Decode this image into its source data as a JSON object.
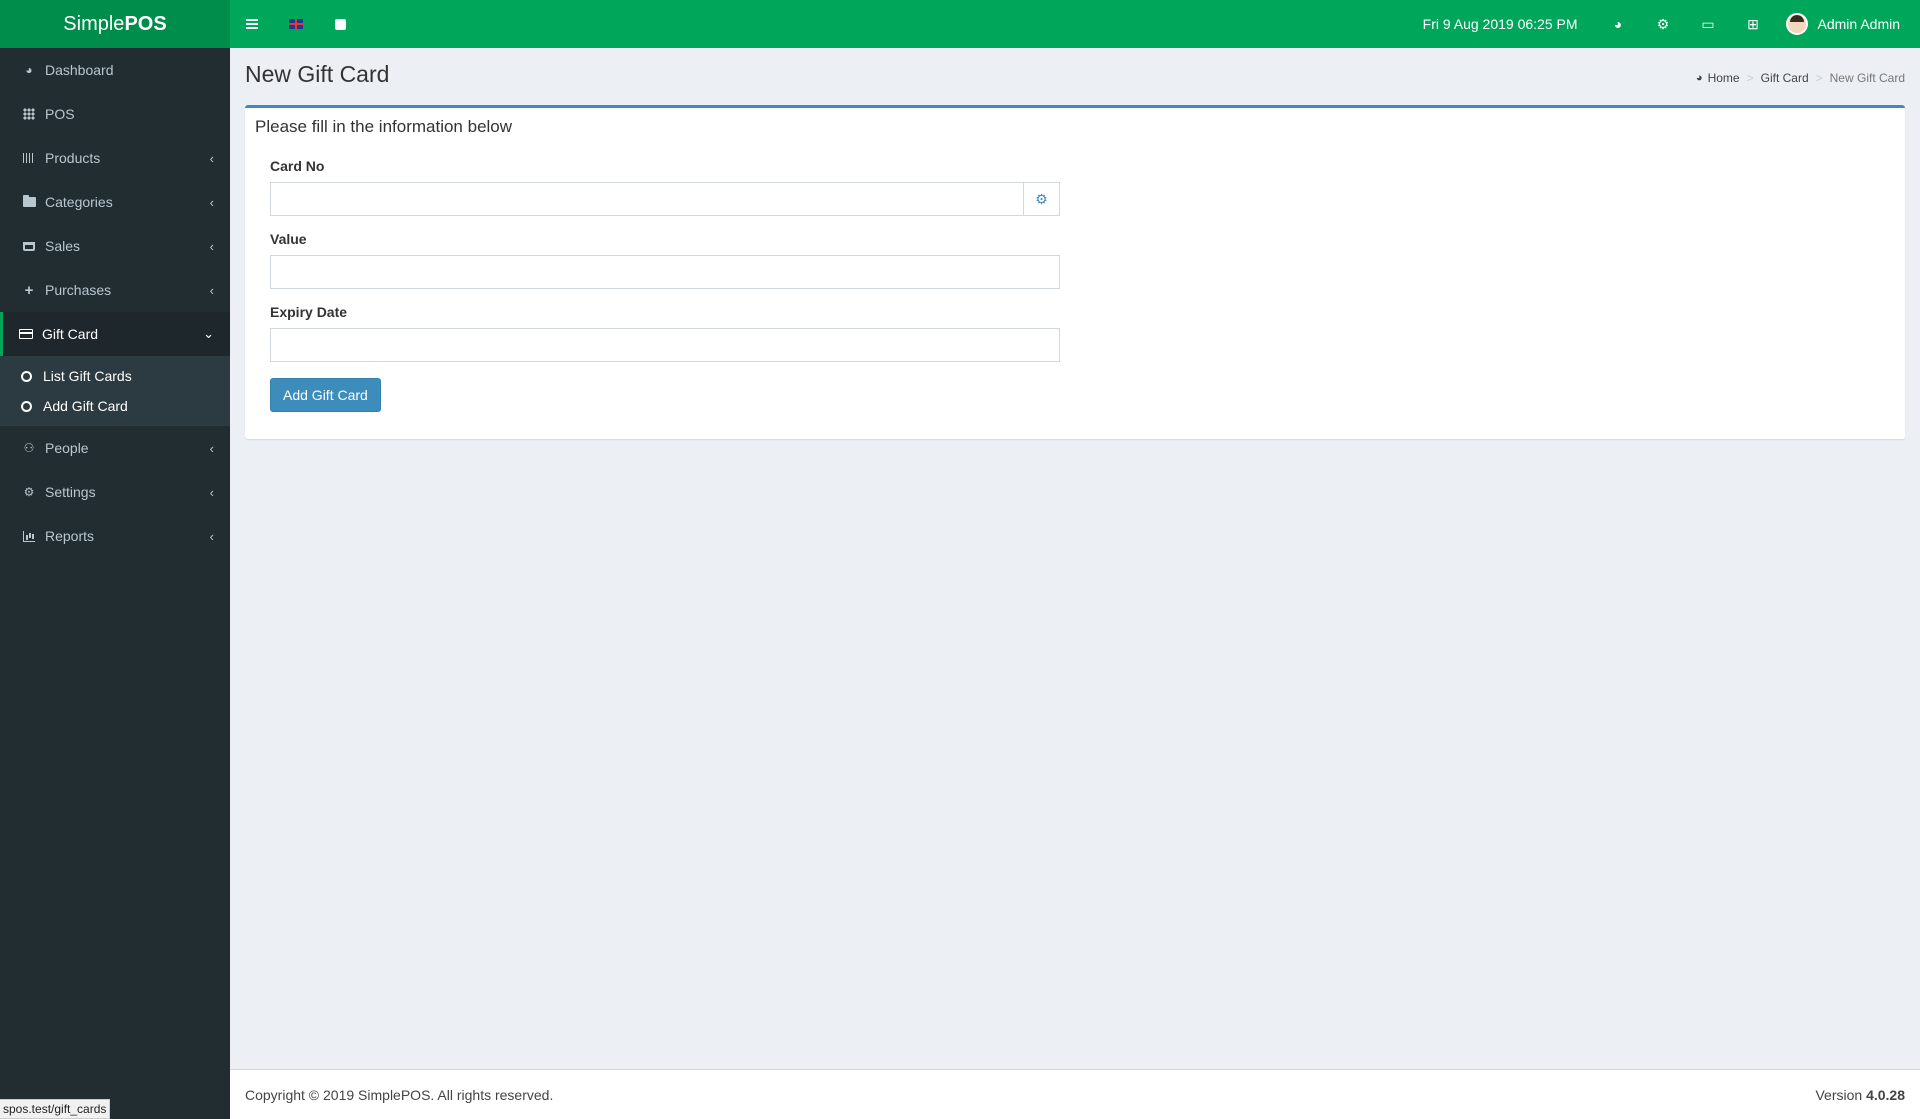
{
  "brand": {
    "light": "Simple",
    "bold": "POS"
  },
  "header": {
    "datetime": "Fri 9 Aug 2019 06:25 PM",
    "user_name": "Admin Admin"
  },
  "sidebar": {
    "items": [
      {
        "label": "Dashboard"
      },
      {
        "label": "POS"
      },
      {
        "label": "Products"
      },
      {
        "label": "Categories"
      },
      {
        "label": "Sales"
      },
      {
        "label": "Purchases"
      },
      {
        "label": "Gift Card"
      },
      {
        "label": "People"
      },
      {
        "label": "Settings"
      },
      {
        "label": "Reports"
      }
    ],
    "gift_card_sub": [
      {
        "label": "List Gift Cards"
      },
      {
        "label": "Add Gift Card"
      }
    ]
  },
  "page": {
    "title": "New Gift Card",
    "breadcrumb": [
      "Home",
      "Gift Card",
      "New Gift Card"
    ],
    "box_title": "Please fill in the information below"
  },
  "form": {
    "card_no_label": "Card No",
    "card_no_value": "",
    "value_label": "Value",
    "value_value": "",
    "expiry_label": "Expiry Date",
    "expiry_value": "",
    "submit_label": "Add Gift Card"
  },
  "footer": {
    "copyright": "Copyright © 2019 SimplePOS. All rights reserved.",
    "version_label": "Version",
    "version": "4.0.28"
  },
  "status_url": "spos.test/gift_cards",
  "colors": {
    "header": "#00a65a",
    "logo_bg": "#008d4c",
    "sidebar": "#222d32",
    "primary": "#3c8dbc"
  },
  "icons": {
    "dashboard": "dashboard-icon",
    "pos": "th-icon",
    "products": "barcode-icon",
    "categories": "folder-icon",
    "sales": "cart-icon",
    "purchases": "plus-icon",
    "gift_card": "credit-card-icon",
    "people": "users-icon",
    "settings": "cogs-icon",
    "reports": "bar-chart-icon"
  }
}
